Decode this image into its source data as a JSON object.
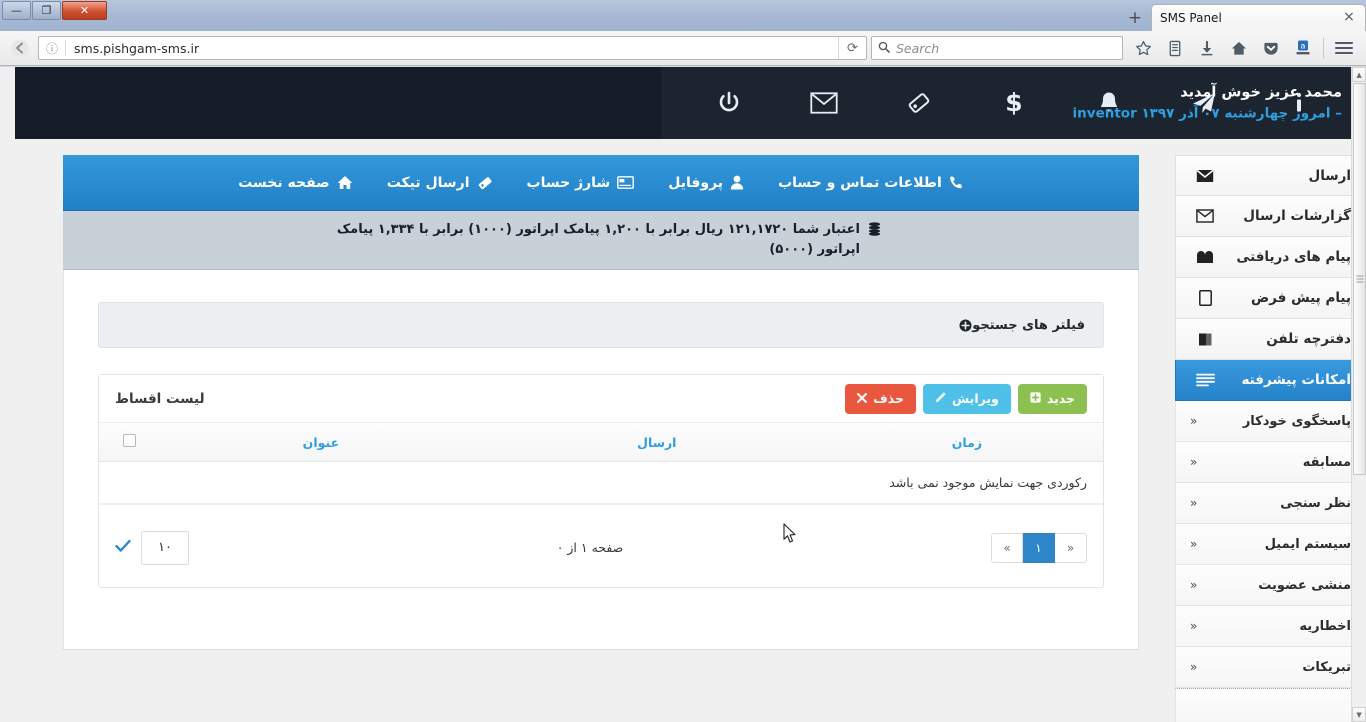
{
  "browser": {
    "tab_title": "SMS Panel",
    "tab_close": "×",
    "new_tab": "+",
    "url": "sms.pishgam-sms.ir",
    "search_placeholder": "Search",
    "reload_glyph": "⟳",
    "back_glyph": "←",
    "forward_glyph": "→",
    "info_glyph": "ⓘ",
    "window": {
      "minimize": "—",
      "restore": "❐",
      "close": "✕"
    },
    "toolbar_icons": [
      "bookmark-star-icon",
      "library-icon",
      "downloads-icon",
      "home-icon",
      "pocket-icon",
      "addon-badge-icon",
      "menu-hamburger-icon"
    ]
  },
  "topbar": {
    "icons": [
      "power-icon",
      "envelope-icon",
      "ticket-tag-icon",
      "dollar-icon",
      "bell-icon",
      "paper-plane-icon",
      "info-icon"
    ],
    "welcome_name": "محمد عزیز خوش آمدید",
    "username": "inventor",
    "today": "– امروز چهارشنبه ۰۷ آذر ۱۳۹۷"
  },
  "mainnav": {
    "items": [
      {
        "label": "صفحه نخست",
        "icon": "home-icon"
      },
      {
        "label": "ارسال تیکت",
        "icon": "tag-icon"
      },
      {
        "label": "شارژ حساب",
        "icon": "credit-card-icon"
      },
      {
        "label": "پروفایل",
        "icon": "user-icon"
      },
      {
        "label": "اطلاعات تماس و حساب",
        "icon": "phone-icon"
      }
    ]
  },
  "credit": {
    "icon": "coins-icon",
    "text": "اعتبار شما ۱۲۱,۱۷۲۰ ریال برابر با ۱,۲۰۰ پیامک اپراتور (۱۰۰۰) برابر با ۱,۳۳۴ پیامک اپراتور (۵۰۰۰)"
  },
  "sidebar": {
    "items": [
      {
        "label": "ارسال",
        "icon": "envelope-filled-icon",
        "active": false
      },
      {
        "label": "گزارشات ارسال",
        "icon": "envelope-outline-icon",
        "active": false
      },
      {
        "label": "پیام های دریافتی",
        "icon": "inbox-icon",
        "active": false
      },
      {
        "label": "پیام پیش فرض",
        "icon": "note-icon",
        "active": false
      },
      {
        "label": "دفترچه تلفن",
        "icon": "book-icon",
        "active": false
      },
      {
        "label": "امکانات پیشرفته",
        "icon": "list-icon",
        "active": true
      }
    ],
    "subitems": [
      {
        "label": "پاسخگوی خودکار",
        "chevron": "«"
      },
      {
        "label": "مسابقه",
        "chevron": "«"
      },
      {
        "label": "نظر سنجی",
        "chevron": "«"
      },
      {
        "label": "سیستم ایمیل",
        "chevron": "«"
      },
      {
        "label": "منشی عضویت",
        "chevron": "«"
      },
      {
        "label": "اخطاریه",
        "chevron": "«"
      },
      {
        "label": "تبریکات",
        "chevron": "«"
      }
    ]
  },
  "filters": {
    "label": "فیلتر های جستجو",
    "icon": "plus-circle-icon"
  },
  "table": {
    "title": "لیست اقساط",
    "buttons": [
      {
        "label": "حذف",
        "icon": "x-icon",
        "style": "danger"
      },
      {
        "label": "ویرایش",
        "icon": "pencil-icon",
        "style": "info"
      },
      {
        "label": "جدید",
        "icon": "plus-icon",
        "style": "success"
      }
    ],
    "headers": [
      "",
      "عنوان",
      "ارسال",
      "زمان"
    ],
    "rows": [],
    "empty_text": "رکوردی جهت نمایش موجود نمی باشد"
  },
  "pager": {
    "prev": "«",
    "current": "۱",
    "next": "»",
    "info": "صفحه ۱ از ۰",
    "per_page": "۱۰",
    "apply_icon": "check-icon"
  },
  "colors": {
    "accent_blue": "#2e9fe0",
    "nav_blue": "#2180c6",
    "topbar_dark": "#141d27",
    "credit_gray": "#c8d0d8",
    "danger": "#e9573f",
    "info": "#4fc1e9",
    "success": "#8cc152"
  }
}
